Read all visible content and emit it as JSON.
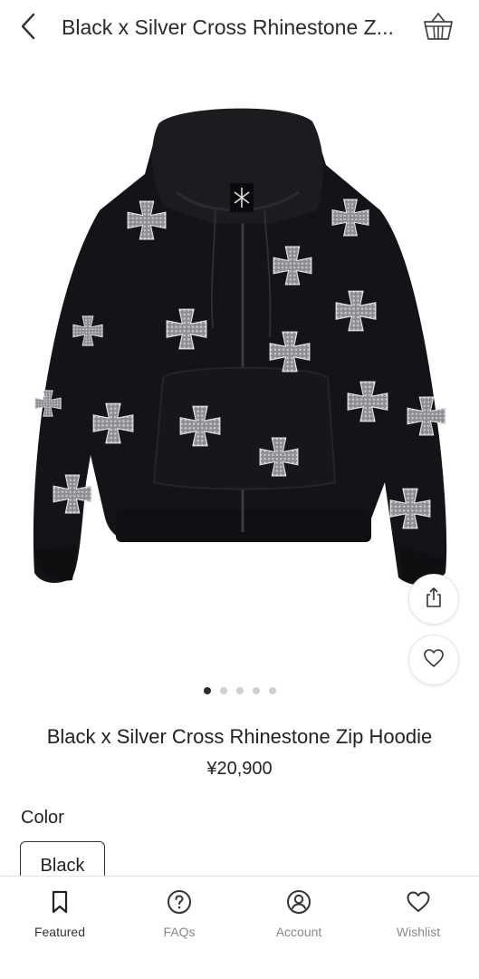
{
  "header": {
    "title": "Black x Silver Cross Rhinestone Z..."
  },
  "icons": {
    "back": "chevron-left-icon",
    "cart": "basket-icon",
    "share": "share-icon",
    "wishlist": "heart-icon"
  },
  "gallery": {
    "image_count": 5,
    "active_index": 0
  },
  "product": {
    "name": "Black x Silver Cross Rhinestone Zip Hoodie",
    "price": "¥20,900",
    "color_label": "Color",
    "selected_color": "Black"
  },
  "bottom_nav": {
    "items": [
      {
        "label": "Featured",
        "icon": "bookmark-icon",
        "active": true
      },
      {
        "label": "FAQs",
        "icon": "question-circle-icon",
        "active": false
      },
      {
        "label": "Account",
        "icon": "account-icon",
        "active": false
      },
      {
        "label": "Wishlist",
        "icon": "heart-icon",
        "active": false
      }
    ]
  },
  "colors": {
    "text": "#222222",
    "muted": "#888888",
    "active_dot": "#2b2b2b",
    "inactive_dot": "#cfcfcf"
  }
}
